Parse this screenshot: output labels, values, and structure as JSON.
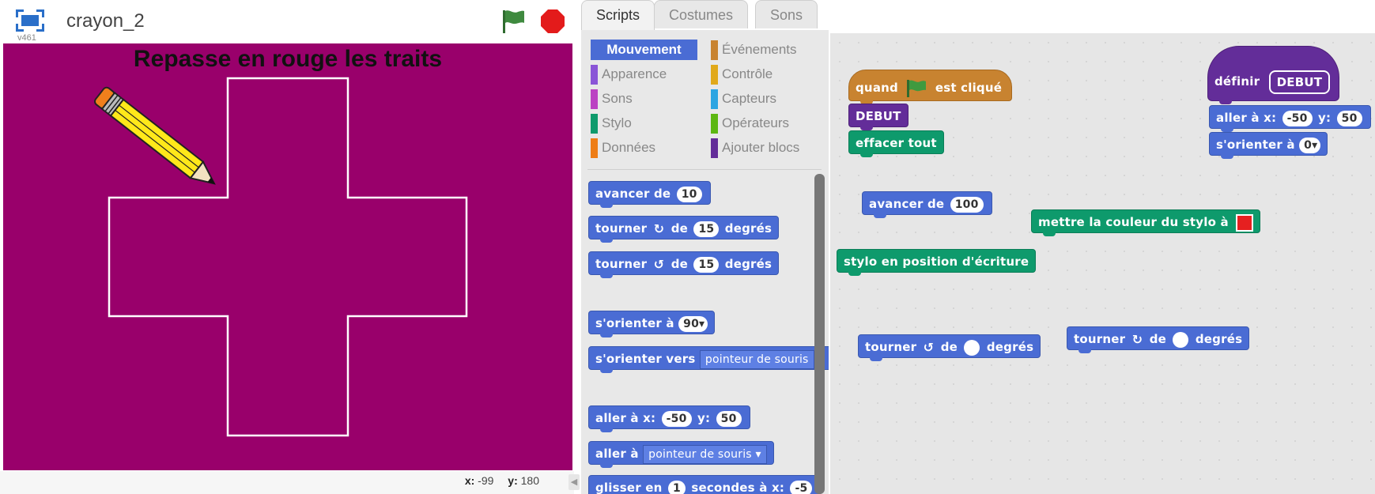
{
  "stage": {
    "version": "v461",
    "project_title": "crayon_2",
    "title_text": "Repasse en rouge les traits",
    "background_color": "#99006b",
    "mouse_x_label": "x:",
    "mouse_x": "-99",
    "mouse_y_label": "y:",
    "mouse_y": "180",
    "collapse_arrow": "◀"
  },
  "tabs": [
    {
      "label": "Scripts"
    },
    {
      "label": "Costumes"
    },
    {
      "label": "Sons"
    }
  ],
  "categories": [
    {
      "label": "Mouvement",
      "color": "#4a6cd4"
    },
    {
      "label": "Apparence",
      "color": "#8a55d7"
    },
    {
      "label": "Sons",
      "color": "#bb42c3"
    },
    {
      "label": "Stylo",
      "color": "#0e9a6c"
    },
    {
      "label": "Données",
      "color": "#ee7d16"
    },
    {
      "label": "Événements",
      "color": "#c88330"
    },
    {
      "label": "Contrôle",
      "color": "#e1a91a"
    },
    {
      "label": "Capteurs",
      "color": "#2ca5e2"
    },
    {
      "label": "Opérateurs",
      "color": "#5cb712"
    },
    {
      "label": "Ajouter blocs",
      "color": "#632d99"
    }
  ],
  "palette_blocks": {
    "move": {
      "label": "avancer de",
      "value": "10"
    },
    "turn_right": {
      "label_a": "tourner",
      "icon": "↻",
      "label_b": "de",
      "value": "15",
      "label_c": "degrés"
    },
    "turn_left": {
      "label_a": "tourner",
      "icon": "↺",
      "label_b": "de",
      "value": "15",
      "label_c": "degrés"
    },
    "point_dir": {
      "label": "s'orienter à",
      "value": "90▾"
    },
    "point_towards": {
      "label": "s'orienter vers",
      "value": "pointeur de souris"
    },
    "goto_xy": {
      "label_a": "aller à x:",
      "x": "-50",
      "label_b": "y:",
      "y": "50"
    },
    "goto": {
      "label": "aller à",
      "value": "pointeur de souris ▾"
    },
    "glide": {
      "label_a": "glisser en",
      "secs": "1",
      "label_b": "secondes à x:",
      "x": "-5"
    }
  },
  "script_blocks": {
    "when_flag": {
      "label_a": "quand",
      "label_b": "est cliqué"
    },
    "debut_call": {
      "label": "DEBUT"
    },
    "clear": {
      "label": "effacer tout"
    },
    "move": {
      "label": "avancer de",
      "value": "100"
    },
    "set_pen_color": {
      "label": "mettre la couleur du stylo à",
      "color": "#e62020"
    },
    "pen_down": {
      "label": "stylo en position d'écriture"
    },
    "turn_left": {
      "label_a": "tourner",
      "icon": "↺",
      "label_b": "de",
      "label_c": "degrés"
    },
    "turn_right": {
      "label_a": "tourner",
      "icon": "↻",
      "label_b": "de",
      "label_c": "degrés"
    },
    "define": {
      "label": "définir",
      "name": "DEBUT"
    },
    "goto_xy": {
      "label_a": "aller à x:",
      "x": "-50",
      "label_b": "y:",
      "y": "50"
    },
    "point_dir": {
      "label": "s'orienter à",
      "value": "0▾"
    }
  }
}
